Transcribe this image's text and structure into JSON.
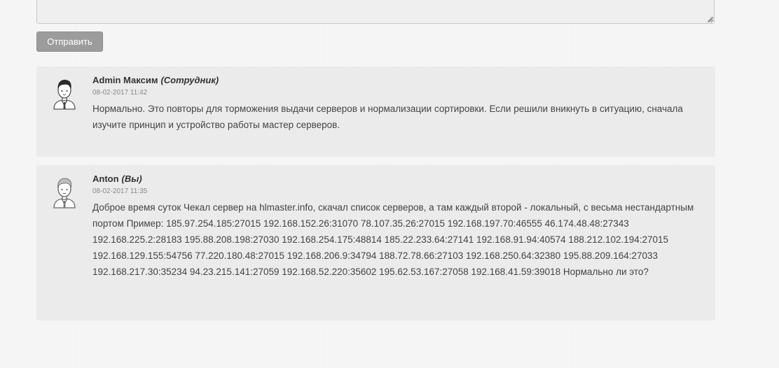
{
  "form": {
    "textarea_value": "",
    "submit_label": "Отправить"
  },
  "comments": [
    {
      "author": "Admin Максим",
      "role": "(Сотрудник)",
      "date": "08-02-2017 11:42",
      "text": "Нормально. Это повторы для торможения выдачи серверов и нормализации сортировки. Если решили вникнуть в ситуацию, сначала изучите принцип и устройство работы мастер серверов.",
      "avatar_icon": "support-agent-avatar-icon"
    },
    {
      "author": "Anton",
      "role": "(Вы)",
      "date": "08-02-2017 11:35",
      "text": "Доброе время суток Чекал сервер на hlmaster.info, скачал список серверов, а там каждый второй - локальный, с весьма нестандартным портом Пример: 185.97.254.185:27015 192.168.152.26:31070 78.107.35.26:27015 192.168.197.70:46555 46.174.48.48:27343 192.168.225.2:28183 195.88.208.198:27030 192.168.254.175:48814 185.22.233.64:27141 192.168.91.94:40574 188.212.102.194:27015 192.168.129.155:54756 77.220.180.48:27015 192.168.206.9:34794 188.72.78.66:27103 192.168.250.64:32380 195.88.209.164:27033 192.168.217.30:35234 94.23.215.141:27059 192.168.52.220:35602 195.62.53.167:27058 192.168.41.59:39018 Нормально ли это?",
      "avatar_icon": "user-avatar-icon"
    }
  ]
}
